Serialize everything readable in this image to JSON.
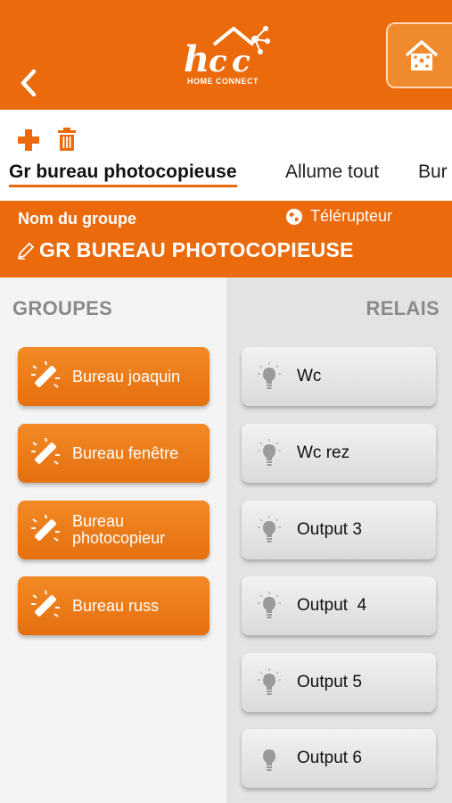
{
  "header": {
    "logo_text": "HOME CONNECT",
    "accent_color": "#ea6a0c"
  },
  "toolbar": {
    "add_icon": "plus-icon",
    "delete_icon": "trash-icon"
  },
  "tabs": [
    {
      "label": "Gr bureau photocopieuse",
      "active": true
    },
    {
      "label": "Allume tout",
      "active": false
    },
    {
      "label": "Bur",
      "active": false
    }
  ],
  "banner": {
    "label": "Nom du groupe",
    "mode": "Télérupteur",
    "name": "GR BUREAU PHOTOCOPIEUSE"
  },
  "groups": {
    "title": "GROUPES",
    "items": [
      {
        "label": "Bureau joaquin"
      },
      {
        "label": "Bureau fenêtre"
      },
      {
        "label": "Bureau\nphotocopieur"
      },
      {
        "label": "Bureau russ"
      }
    ]
  },
  "relays": {
    "title": "RELAIS",
    "items": [
      {
        "label": "Wc"
      },
      {
        "label": "Wc rez"
      },
      {
        "label": "Output 3"
      },
      {
        "label": "Output  4"
      },
      {
        "label": "Output 5"
      },
      {
        "label": "Output 6"
      }
    ]
  }
}
